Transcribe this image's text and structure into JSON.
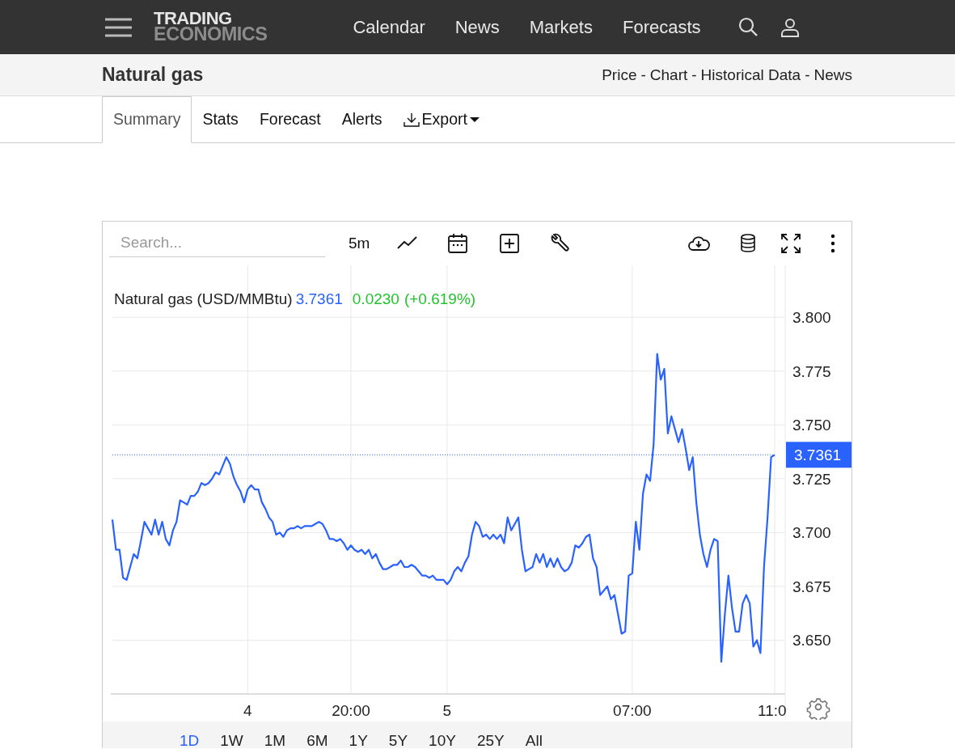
{
  "navbar": {
    "logo_lines": [
      "TRADING",
      "ECONOMICS"
    ],
    "links": [
      "Calendar",
      "News",
      "Markets",
      "Forecasts"
    ]
  },
  "header": {
    "title": "Natural gas",
    "separator": "-",
    "links": [
      "Price",
      "Chart",
      "Historical Data",
      "News"
    ]
  },
  "tabs": [
    {
      "label": "Summary",
      "kind": "tab",
      "selected": true
    },
    {
      "label": "Stats",
      "kind": "tab",
      "selected": false
    },
    {
      "label": "Forecast",
      "kind": "tab",
      "selected": false
    },
    {
      "label": "Alerts",
      "kind": "tab",
      "selected": false
    },
    {
      "label": "Export",
      "kind": "dropdown",
      "selected": false
    }
  ],
  "chart_widget": {
    "search": {
      "placeholder": "Search..."
    },
    "interval": "5m",
    "legend": {
      "name": "Natural gas (USD/MMBtu)",
      "price": "3.7361",
      "change": "0.0230",
      "change_pct": "(+0.619%)"
    },
    "chart_data": {
      "type": "line",
      "categories": [
        null,
        null,
        null,
        null,
        null,
        null,
        null,
        null,
        null,
        null,
        null,
        null,
        null,
        null,
        null,
        null,
        null,
        null,
        null,
        null,
        null,
        null,
        null,
        null,
        null,
        null,
        null,
        null,
        null,
        null,
        null,
        null,
        null,
        null,
        null,
        null,
        null,
        null,
        "4",
        null,
        null,
        null,
        null,
        null,
        null,
        null,
        null,
        null,
        null,
        null,
        null,
        null,
        null,
        null,
        null,
        null,
        null,
        null,
        null,
        null,
        null,
        null,
        null,
        null,
        null,
        null,
        null,
        "20:00",
        null,
        null,
        null,
        null,
        null,
        null,
        null,
        null,
        null,
        null,
        null,
        null,
        null,
        null,
        null,
        null,
        null,
        null,
        null,
        null,
        null,
        null,
        null,
        null,
        null,
        null,
        "5",
        null,
        null,
        null,
        null,
        null,
        null,
        null,
        null,
        null,
        null,
        null,
        null,
        null,
        null,
        null,
        null,
        null,
        null,
        null,
        null,
        null,
        null,
        null,
        null,
        null,
        null,
        null,
        null,
        null,
        null,
        null,
        null,
        null,
        null,
        null,
        null,
        null,
        null,
        null,
        null,
        null,
        null,
        null,
        null,
        null,
        null,
        null,
        null,
        null,
        null,
        null,
        "07:00",
        null,
        null,
        null,
        null,
        null,
        null,
        null,
        null,
        null,
        null,
        null,
        null,
        null,
        null,
        null,
        null,
        null,
        null,
        null,
        null,
        null,
        null,
        null,
        null,
        null,
        null,
        null,
        null,
        null,
        null,
        null,
        null,
        null,
        null,
        null,
        null,
        null,
        null,
        null,
        "11:0"
      ],
      "series": [
        {
          "color": "#2962ff",
          "values": [
            3.706,
            3.692,
            3.692,
            3.679,
            3.678,
            3.684,
            3.69,
            3.688,
            3.696,
            3.705,
            3.702,
            3.699,
            3.706,
            3.699,
            3.705,
            3.697,
            3.694,
            3.701,
            3.705,
            3.715,
            3.714,
            3.713,
            3.717,
            3.717,
            3.719,
            3.723,
            3.722,
            3.723,
            3.725,
            3.728,
            3.727,
            3.731,
            3.735,
            3.732,
            3.726,
            3.722,
            3.719,
            3.714,
            3.72,
            3.722,
            3.72,
            3.72,
            3.714,
            3.711,
            3.707,
            3.705,
            3.699,
            3.7,
            3.698,
            3.701,
            3.702,
            3.702,
            3.703,
            3.702,
            3.703,
            3.703,
            3.703,
            3.704,
            3.705,
            3.704,
            3.701,
            3.697,
            3.697,
            3.696,
            3.697,
            3.695,
            3.692,
            3.694,
            3.692,
            3.691,
            3.692,
            3.69,
            3.692,
            3.688,
            3.69,
            3.686,
            3.683,
            3.683,
            3.684,
            3.685,
            3.685,
            3.687,
            3.684,
            3.684,
            3.685,
            3.684,
            3.682,
            3.68,
            3.68,
            3.679,
            3.68,
            3.678,
            3.678,
            3.678,
            3.676,
            3.678,
            3.682,
            3.684,
            3.682,
            3.686,
            3.689,
            3.699,
            3.705,
            3.703,
            3.698,
            3.699,
            3.697,
            3.699,
            3.697,
            3.699,
            3.695,
            3.707,
            3.701,
            3.704,
            3.707,
            3.692,
            3.682,
            3.683,
            3.684,
            3.69,
            3.686,
            3.69,
            3.684,
            3.688,
            3.684,
            3.688,
            3.684,
            3.682,
            3.683,
            3.686,
            3.694,
            3.693,
            3.695,
            3.698,
            3.699,
            3.688,
            3.684,
            3.671,
            3.673,
            3.675,
            3.669,
            3.671,
            3.662,
            3.653,
            3.654,
            3.68,
            3.681,
            3.705,
            3.692,
            3.718,
            3.727,
            3.724,
            3.741,
            3.783,
            3.771,
            3.776,
            3.746,
            3.754,
            3.748,
            3.742,
            3.748,
            3.739,
            3.729,
            3.735,
            3.714,
            3.699,
            3.69,
            3.684,
            3.692,
            3.697,
            3.696,
            3.64,
            3.662,
            3.68,
            3.665,
            3.654,
            3.654,
            3.667,
            3.671,
            3.667,
            3.647,
            3.65,
            3.644,
            3.684,
            3.707,
            3.735,
            3.7361
          ]
        }
      ],
      "ylim": [
        3.625,
        3.823
      ],
      "yticks": [
        {
          "value": 3.65,
          "label": "3.650"
        },
        {
          "value": 3.675,
          "label": "3.675"
        },
        {
          "value": 3.7,
          "label": "3.700"
        },
        {
          "value": 3.725,
          "label": "3.725"
        },
        {
          "value": 3.75,
          "label": "3.750"
        },
        {
          "value": 3.775,
          "label": "3.775"
        },
        {
          "value": 3.8,
          "label": "3.800"
        }
      ],
      "grid": true,
      "ref_lines": [
        {
          "axis": "y",
          "value": 3.7361,
          "label": "3.7361"
        }
      ]
    },
    "ranges": [
      {
        "label": "1D",
        "selected": true
      },
      {
        "label": "1W",
        "selected": false
      },
      {
        "label": "1M",
        "selected": false
      },
      {
        "label": "6M",
        "selected": false
      },
      {
        "label": "1Y",
        "selected": false
      },
      {
        "label": "5Y",
        "selected": false
      },
      {
        "label": "10Y",
        "selected": false
      },
      {
        "label": "25Y",
        "selected": false
      },
      {
        "label": "All",
        "selected": false
      }
    ]
  }
}
